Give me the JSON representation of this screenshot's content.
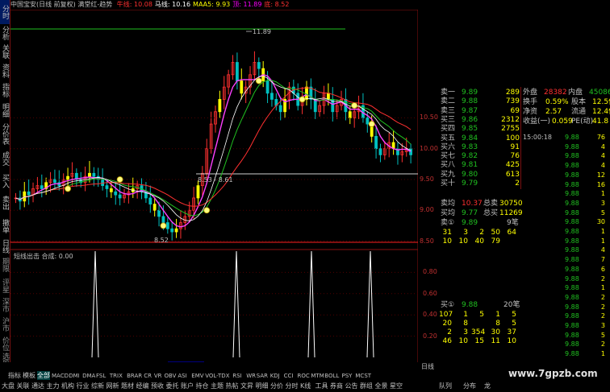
{
  "header": {
    "title": "中国宝安(日线 前复权) 满堂红-趋势",
    "ma_items": [
      {
        "label": "牛线: 10.08",
        "color": "#ff3030"
      },
      {
        "label": "马线: 10.16",
        "color": "#ffffff"
      },
      {
        "label": "MAA5: 9.93",
        "color": "#ffff00"
      },
      {
        "label": "顶: 11.89",
        "color": "#ff00ff"
      },
      {
        "label": "底: 8.52",
        "color": "#ff3030"
      }
    ]
  },
  "sidebar": {
    "tabs": [
      "分时",
      "分析",
      "关联",
      "资料",
      "指标",
      "明细",
      "分价表",
      "成交",
      "买入",
      "卖出",
      "撤单",
      "日线"
    ],
    "lower_tabs": [
      "期限",
      "评星",
      "深市",
      "沪市",
      "价位",
      "选股",
      "资金"
    ]
  },
  "chart": {
    "price_labels": [
      "10.50",
      "10.00",
      "9.50",
      "9.00",
      "8.50"
    ],
    "annotations": {
      "high": "11.89",
      "low": "8.52",
      "range": "8.53 - 8.61"
    },
    "sub_title": "短线出击 合成: 0.00",
    "sub_labels": [
      "0.80",
      "0.60",
      "0.40",
      "0.20"
    ],
    "date_axis": [
      "2013年",
      "12",
      "1",
      "2014/01/20/—",
      "3",
      "4",
      "5"
    ]
  },
  "quote": {
    "sell": [
      {
        "label": "卖一",
        "price": "9.89",
        "vol": "289"
      },
      {
        "label": "卖二",
        "price": "9.88",
        "vol": "739"
      },
      {
        "label": "卖三",
        "price": "9.87",
        "vol": "69"
      },
      {
        "label": "买三",
        "price": "9.86",
        "vol": "2312"
      },
      {
        "label": "买四",
        "price": "9.85",
        "vol": "2755"
      },
      {
        "label": "买五",
        "price": "9.84",
        "vol": "100"
      },
      {
        "label": "买六",
        "price": "9.83",
        "vol": "91"
      },
      {
        "label": "买七",
        "price": "9.82",
        "vol": "76"
      },
      {
        "label": "买八",
        "price": "9.81",
        "vol": "425"
      },
      {
        "label": "买九",
        "price": "9.80",
        "vol": "613"
      },
      {
        "label": "买十",
        "price": "9.79",
        "vol": "2"
      }
    ],
    "avg": {
      "label": "卖均",
      "price": "10.37",
      "k": "总卖",
      "v": "30750"
    },
    "buyavg": {
      "label": "买均",
      "price": "9.77",
      "k": "总买",
      "v": "11269"
    },
    "sell1": {
      "label": "卖①",
      "price": "9.89",
      "count": "9笔"
    },
    "sell1_rows": [
      [
        "31",
        "3",
        "2",
        "50",
        "64"
      ],
      [
        "10",
        "10",
        "40",
        "79",
        ""
      ]
    ],
    "buy1": {
      "label": "买①",
      "price": "9.88",
      "count": "20笔"
    },
    "buy1_rows": [
      [
        "107",
        "1",
        "5",
        "1",
        "5"
      ],
      [
        "20",
        "8",
        "",
        "8",
        "5"
      ],
      [
        "2",
        "3",
        "354",
        "30",
        "37"
      ],
      [
        "46",
        "10",
        "15",
        "11",
        "10"
      ]
    ]
  },
  "stats": {
    "outer_label": "外盘",
    "outer": "28382",
    "inner_label": "内盘",
    "inner": "45086",
    "rows": [
      {
        "k1": "换手",
        "v1": "0.59%",
        "k2": "股本",
        "v2": "12.5亿"
      },
      {
        "k1": "净资",
        "v1": "2.57",
        "k2": "流通",
        "v2": "12.4亿"
      },
      {
        "k1": "收益(一)",
        "v1": "0.059",
        "k2": "PE(动)",
        "v2": "41.8"
      }
    ]
  },
  "ticks": [
    {
      "t": "15:00:18",
      "p": "9.88",
      "v": "76"
    },
    {
      "t": "",
      "p": "9.88",
      "v": "4"
    },
    {
      "t": "",
      "p": "9.88",
      "v": "4"
    },
    {
      "t": "",
      "p": "9.88",
      "v": "4"
    },
    {
      "t": "",
      "p": "9.88",
      "v": "12"
    },
    {
      "t": "",
      "p": "9.88",
      "v": "16"
    },
    {
      "t": "",
      "p": "9.88",
      "v": "1"
    },
    {
      "t": "",
      "p": "9.88",
      "v": "3"
    },
    {
      "t": "",
      "p": "9.88",
      "v": "5"
    },
    {
      "t": "",
      "p": "9.88",
      "v": "30"
    },
    {
      "t": "",
      "p": "9.88",
      "v": "1"
    },
    {
      "t": "",
      "p": "9.88",
      "v": "1"
    },
    {
      "t": "",
      "p": "9.88",
      "v": "4"
    },
    {
      "t": "",
      "p": "9.88",
      "v": "7"
    },
    {
      "t": "",
      "p": "9.88",
      "v": "6"
    },
    {
      "t": "",
      "p": "9.88",
      "v": "2"
    },
    {
      "t": "",
      "p": "9.88",
      "v": "1"
    },
    {
      "t": "",
      "p": "9.88",
      "v": "2"
    },
    {
      "t": "",
      "p": "9.88",
      "v": "2"
    },
    {
      "t": "",
      "p": "9.88",
      "v": "2"
    },
    {
      "t": "",
      "p": "9.88",
      "v": "3"
    },
    {
      "t": "",
      "p": "9.88",
      "v": "5"
    },
    {
      "t": "",
      "p": "9.88",
      "v": "2"
    },
    {
      "t": "",
      "p": "9.88",
      "v": "1"
    }
  ],
  "bottom": {
    "tabs": [
      "指标",
      "模板",
      "全部"
    ],
    "indicators": [
      "MACD",
      "DMI",
      "DMA",
      "FSL",
      "TRIX",
      "BRAR",
      "CR",
      "VR",
      "OBV",
      "ASI",
      "EMV",
      "VOL-TDX",
      "RSI",
      "WR",
      "SAR",
      "KDJ",
      "CCI",
      "ROC",
      "MTM",
      "BOLL",
      "PSY",
      "MCST"
    ],
    "row3": [
      "大盘",
      "关联",
      "通达",
      "主力",
      "机构",
      "行业",
      "综新",
      "网新",
      "题材",
      "经编",
      "预收",
      "委托",
      "账户",
      "持仓",
      "主题",
      "热帖",
      "文昇",
      "明细",
      "分价",
      "分时",
      "K线",
      "工具",
      "券商",
      "公告",
      "群组",
      "全景",
      "星空"
    ],
    "right_tabs": [
      "日线",
      "队列",
      "分布",
      "龙"
    ],
    "watermark": "www.7gpzb.com"
  }
}
